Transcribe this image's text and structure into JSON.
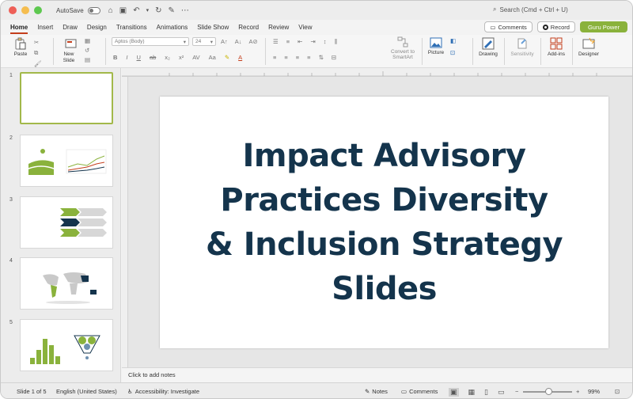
{
  "titlebar": {
    "autosave_label": "AutoSave",
    "search_placeholder": "Search (Cmd + Ctrl + U)"
  },
  "tabs": [
    {
      "label": "Home",
      "active": true
    },
    {
      "label": "Insert"
    },
    {
      "label": "Draw"
    },
    {
      "label": "Design"
    },
    {
      "label": "Transitions"
    },
    {
      "label": "Animations"
    },
    {
      "label": "Slide Show"
    },
    {
      "label": "Record"
    },
    {
      "label": "Review"
    },
    {
      "label": "View"
    }
  ],
  "actions": {
    "comments_label": "Comments",
    "record_label": "Record",
    "guru_label": "Guru Power"
  },
  "ribbon": {
    "paste_label": "Paste",
    "new_slide_label": "New Slide",
    "font_name": "Aptos (Body)",
    "font_size": "24",
    "convert_label": "Convert to SmartArt",
    "picture_label": "Picture",
    "drawing_label": "Drawing",
    "sensitivity_label": "Sensitivity",
    "addins_label": "Add-ins",
    "designer_label": "Designer"
  },
  "thumbnails": [
    {
      "num": "1",
      "selected": true
    },
    {
      "num": "2"
    },
    {
      "num": "3"
    },
    {
      "num": "4"
    },
    {
      "num": "5"
    }
  ],
  "slide": {
    "title_line1": "Impact Advisory",
    "title_line2": "Practices Diversity",
    "title_line3": "& Inclusion Strategy",
    "title_line4": "Slides",
    "title_color": "#14344c"
  },
  "notes_placeholder": "Click to add notes",
  "status": {
    "slide_counter": "Slide 1 of 5",
    "language": "English (United States)",
    "accessibility": "Accessibility: Investigate",
    "notes_label": "Notes",
    "comments_label": "Comments",
    "zoom": "99%"
  },
  "colors": {
    "accent_green": "#8ab23c",
    "active_tab_underline": "#c43e1c",
    "navy": "#14344c"
  }
}
